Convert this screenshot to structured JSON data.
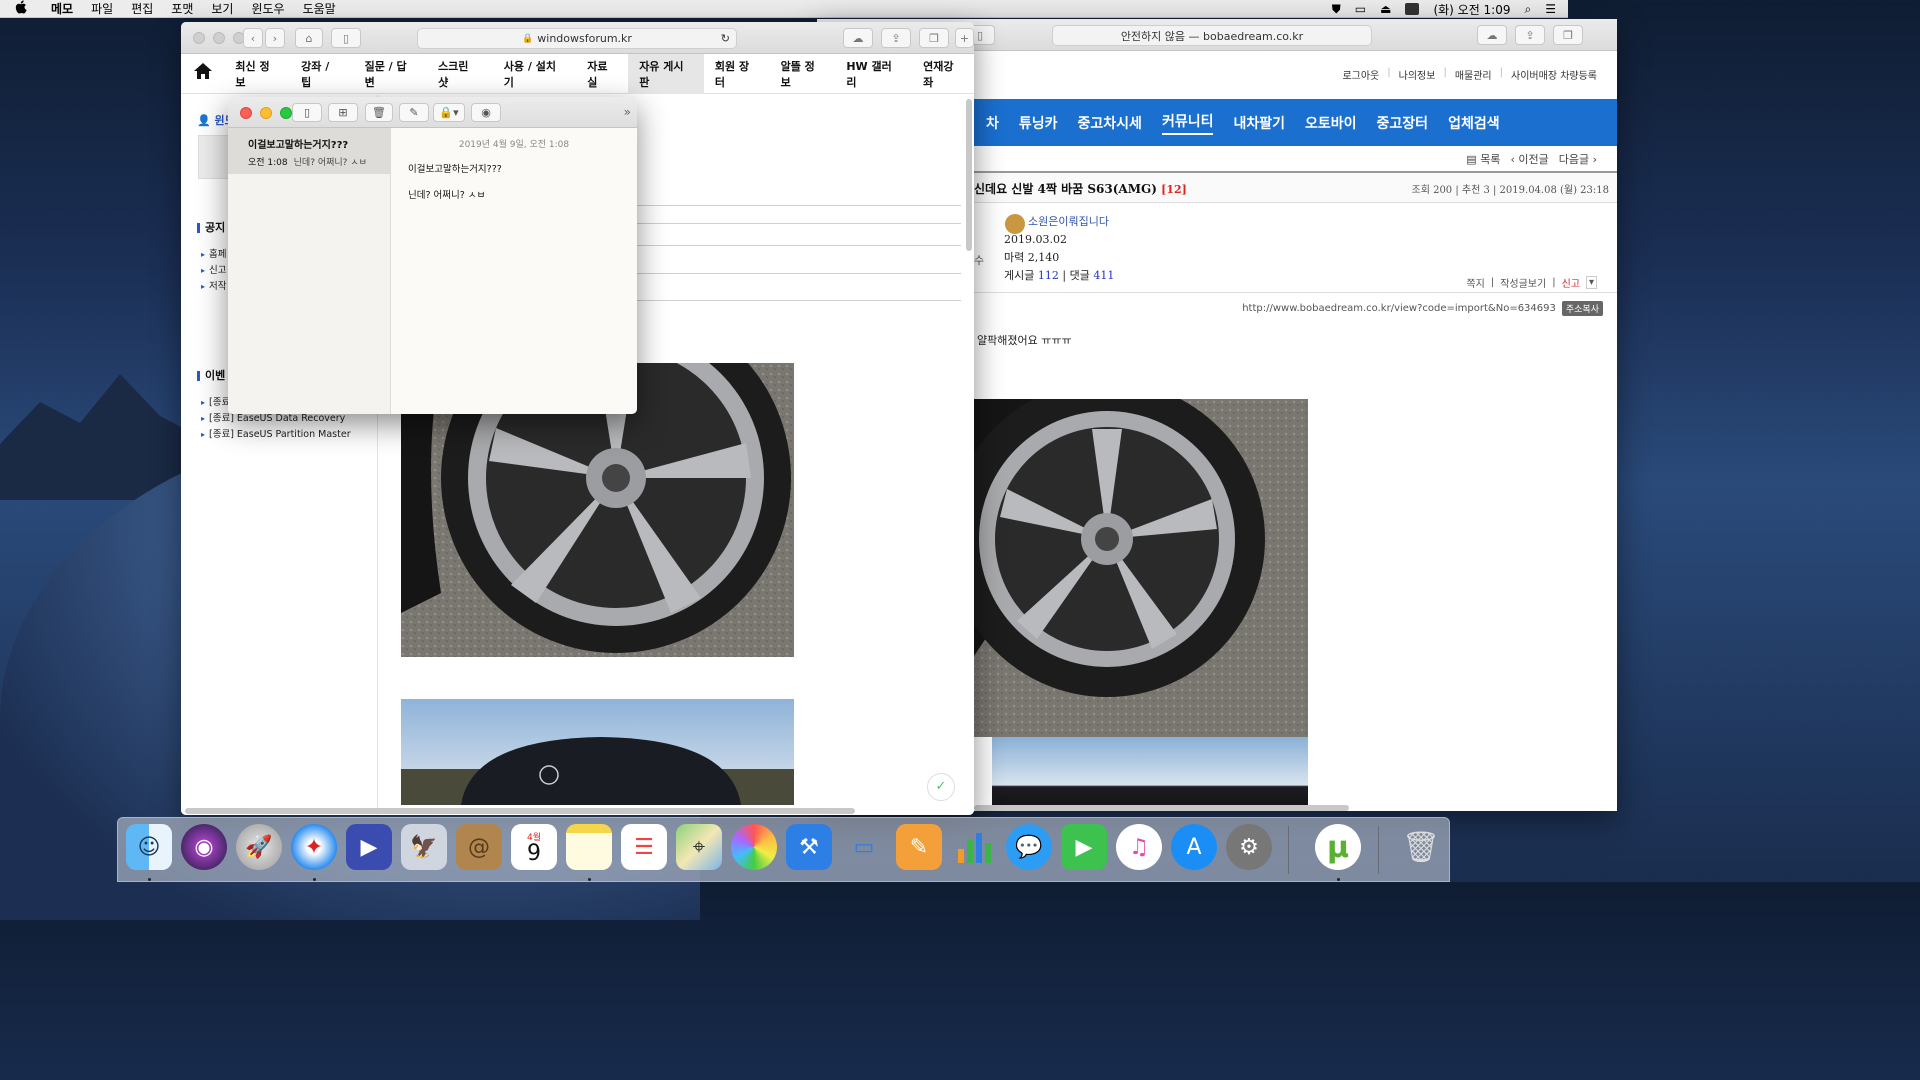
{
  "menubar": {
    "apple": "",
    "items": [
      "메모",
      "파일",
      "편집",
      "포맷",
      "보기",
      "윈도우",
      "도움말"
    ],
    "clock": "(화) 오전 1:09"
  },
  "safari_front": {
    "url": "windowsforum.kr",
    "nav": [
      "최신 정보",
      "강좌 / 팁",
      "질문 / 답변",
      "스크린 샷",
      "사용 / 설치기",
      "자료실",
      "자유 게시판",
      "회원 장터",
      "알뜰 정보",
      "HW 갤러리",
      "연재강좌"
    ],
    "active_nav": "자유 게시판",
    "sidebar": {
      "user_label": "윈도",
      "notice_label": "공지",
      "notice_items": [
        "홈페",
        "신고",
        "저작"
      ],
      "event_label": "이벤",
      "event_items": [
        "[종료]",
        "[종료] EaseUS Data Recovery",
        "[종료] EaseUS Partition Master"
      ]
    }
  },
  "safari_back": {
    "url": "안전하지 않음 — bobaedream.co.kr",
    "top_links": [
      "로그아웃",
      "나의정보",
      "매물관리",
      "사이버매장 차량등록"
    ],
    "nav": [
      "차",
      "튜닝카",
      "중고차시세",
      "커뮤니티",
      "내차팔기",
      "오토바이",
      "중고장터",
      "업체검색"
    ],
    "active_nav": "커뮤니티",
    "post_links": [
      "목록",
      "이전글",
      "다음글"
    ],
    "post_title": "신데요 신발 4짝 바꿈 S63(AMG)",
    "comment_count": "[12]",
    "post_meta": "조회 200 | 추천 3 | 2019.04.08 (월) 23:18",
    "author": "소원은이뤄집니다",
    "join_date": "2019.03.02",
    "power_label": "마력",
    "power_value": "2,140",
    "posts_label": "게시글",
    "posts_value": "112",
    "comments_label": "댓글",
    "comments_value": "411",
    "side_labels": [
      "",
      "수",
      ""
    ],
    "actions": [
      "쪽지",
      "작성글보기",
      "신고"
    ],
    "post_url": "http://www.bobaedream.co.kr/view?code=import&No=634693",
    "copy_label": "주소복사",
    "body_text": "얄팍해졌어요 ㅠㅠㅠ"
  },
  "notes": {
    "note_title": "이걸보고말하는거지???",
    "note_time": "오전 1:08",
    "note_preview": "닌데? 어쩌니? ㅅㅂ",
    "date": "2019년 4월 9일, 오전 1:08",
    "body": [
      "이걸보고말하는거지???",
      "닌데? 어쩌니? ㅅㅂ"
    ]
  },
  "dock": {
    "calendar_month": "4월",
    "calendar_day": "9",
    "apps": [
      "finder-icon",
      "siri-icon",
      "launchpad-icon",
      "safari-icon",
      "keynote-remote-icon",
      "mail-preview-icon",
      "contacts-icon",
      "calendar-icon",
      "notes-icon",
      "reminders-icon",
      "maps-icon",
      "photos-icon",
      "xcode-icon",
      "keynote-icon",
      "pages-icon",
      "numbers-icon",
      "messages-icon",
      "facetime-icon",
      "itunes-icon",
      "app-store-icon",
      "system-preferences-icon",
      "utorrent-icon",
      "trash-icon"
    ]
  }
}
